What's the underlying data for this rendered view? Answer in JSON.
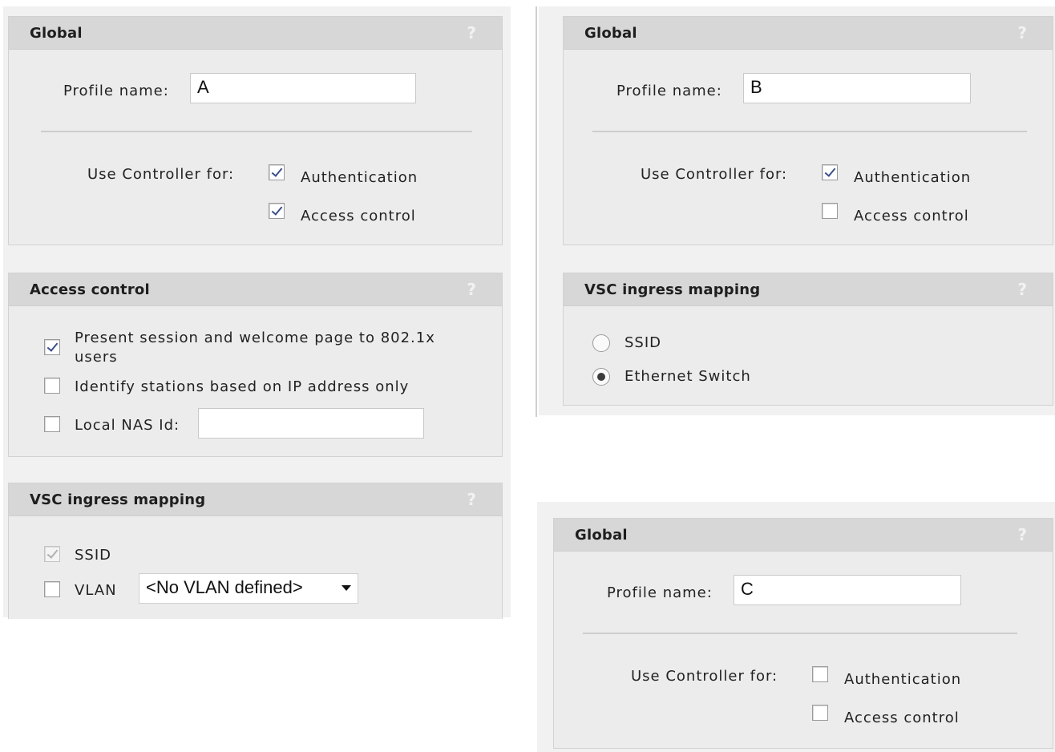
{
  "help_glyph": "?",
  "profile_name_label": "Profile name:",
  "use_controller_label": "Use Controller for:",
  "authentication_label": "Authentication",
  "access_control_option_label": "Access control",
  "profiles": {
    "a": {
      "global_title": "Global",
      "profile_name": "A",
      "authentication_checked": true,
      "access_control_checked": true,
      "access_control_panel": {
        "title": "Access control",
        "present_session_label_line1": "Present session and welcome page to 802.1x",
        "present_session_label_line2": "users",
        "present_session_checked": true,
        "identify_stations_label": "Identify stations based on IP address only",
        "identify_stations_checked": false,
        "local_nas_label": "Local NAS Id:",
        "local_nas_checked": false,
        "local_nas_value": ""
      },
      "vsc_panel": {
        "title": "VSC ingress mapping",
        "ssid_label": "SSID",
        "ssid_checked": true,
        "ssid_disabled": true,
        "vlan_label": "VLAN",
        "vlan_checked": false,
        "vlan_select_value": "<No VLAN defined>"
      }
    },
    "b": {
      "global_title": "Global",
      "profile_name": "B",
      "authentication_checked": true,
      "access_control_checked": false,
      "vsc_panel": {
        "title": "VSC ingress mapping",
        "ssid_label": "SSID",
        "ethernet_switch_label": "Ethernet Switch",
        "selected": "Ethernet Switch"
      }
    },
    "c": {
      "global_title": "Global",
      "profile_name": "C",
      "authentication_checked": false,
      "access_control_checked": false
    }
  }
}
